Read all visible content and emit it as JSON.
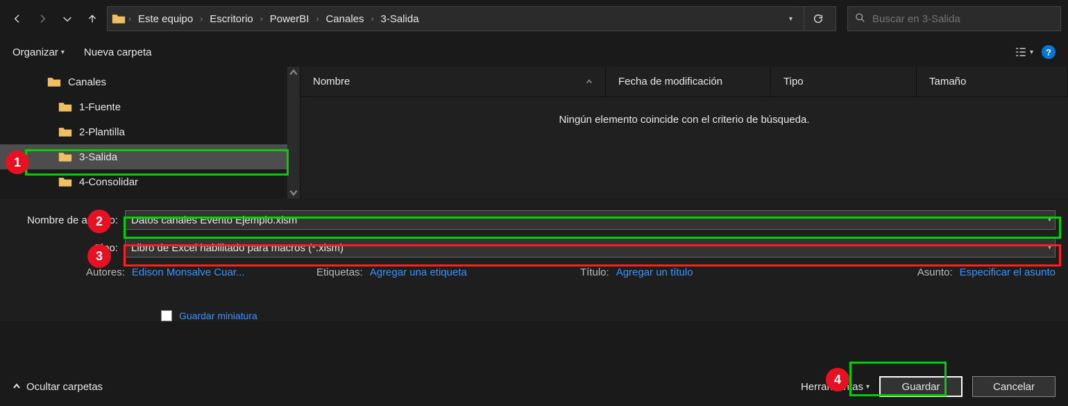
{
  "breadcrumb": {
    "items": [
      "Este equipo",
      "Escritorio",
      "PowerBI",
      "Canales",
      "3-Salida"
    ]
  },
  "search": {
    "placeholder": "Buscar en 3-Salida"
  },
  "toolbar": {
    "organize": "Organizar",
    "new_folder": "Nueva carpeta",
    "help": "?"
  },
  "tree": {
    "items": [
      {
        "label": "Canales",
        "depth": 0,
        "selected": false
      },
      {
        "label": "1-Fuente",
        "depth": 1,
        "selected": false
      },
      {
        "label": "2-Plantilla",
        "depth": 1,
        "selected": false
      },
      {
        "label": "3-Salida",
        "depth": 1,
        "selected": true
      },
      {
        "label": "4-Consolidar",
        "depth": 1,
        "selected": false
      }
    ]
  },
  "columns": {
    "name": "Nombre",
    "date": "Fecha de modificación",
    "type": "Tipo",
    "size": "Tamaño"
  },
  "empty_message": "Ningún elemento coincide con el criterio de búsqueda.",
  "fields": {
    "filename_label": "Nombre de archivo:",
    "filename_value": "Datos canales Evento Ejemplo.xlsm",
    "filetype_label": "Tipo:",
    "filetype_value": "Libro de Excel habilitado para macros (*.xlsm)"
  },
  "meta": {
    "authors_label": "Autores:",
    "authors_value": "Edison Monsalve Cuar...",
    "tags_label": "Etiquetas:",
    "tags_value": "Agregar una etiqueta",
    "title_label": "Título:",
    "title_value": "Agregar un título",
    "subject_label": "Asunto:",
    "subject_value": "Especificar el asunto",
    "save_thumbnail": "Guardar miniatura"
  },
  "footer": {
    "hide_folders": "Ocultar carpetas",
    "tools": "Herramientas",
    "save": "Guardar",
    "cancel": "Cancelar"
  },
  "annotations": {
    "n1": "1",
    "n2": "2",
    "n3": "3",
    "n4": "4"
  }
}
